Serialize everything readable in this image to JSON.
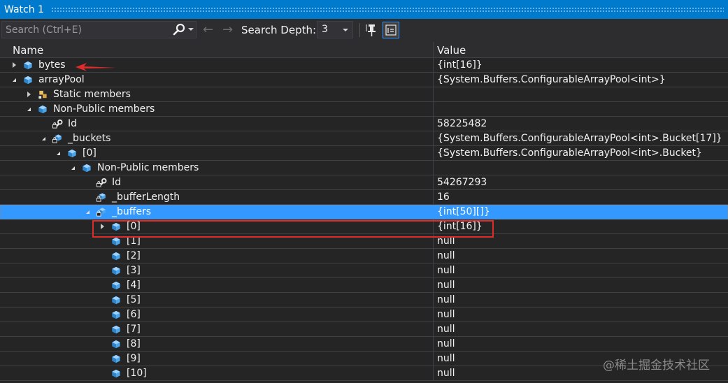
{
  "window": {
    "title": "Watch 1"
  },
  "toolbar": {
    "search_placeholder": "Search (Ctrl+E)",
    "search_depth_label": "Search Depth:",
    "search_depth_value": "3"
  },
  "columns": {
    "name": "Name",
    "value": "Value"
  },
  "rows": [
    {
      "name": "bytes",
      "value": "{int[16]}",
      "expander": "collapsed",
      "icon": "field-icon"
    },
    {
      "name": "arrayPool",
      "value": "{System.Buffers.ConfigurableArrayPool<int>}",
      "expander": "expanded",
      "icon": "field-icon"
    },
    {
      "name": "Static members",
      "value": "",
      "expander": "collapsed",
      "icon": "static-members-icon"
    },
    {
      "name": "Non-Public members",
      "value": "",
      "expander": "expanded",
      "icon": "field-icon"
    },
    {
      "name": "Id",
      "value": "58225482",
      "expander": "none",
      "icon": "private-property-icon"
    },
    {
      "name": "_buckets",
      "value": "{System.Buffers.ConfigurableArrayPool<int>.Bucket[17]}",
      "expander": "expanded",
      "icon": "private-field-icon"
    },
    {
      "name": "[0]",
      "value": "{System.Buffers.ConfigurableArrayPool<int>.Bucket}",
      "expander": "expanded",
      "icon": "field-icon"
    },
    {
      "name": "Non-Public members",
      "value": "",
      "expander": "expanded",
      "icon": "field-icon"
    },
    {
      "name": "Id",
      "value": "54267293",
      "expander": "none",
      "icon": "private-property-icon"
    },
    {
      "name": "_bufferLength",
      "value": "16",
      "expander": "none",
      "icon": "private-field-icon"
    },
    {
      "name": "_buffers",
      "value": "{int[50][]}",
      "expander": "expanded",
      "icon": "private-field-icon",
      "selected": true
    },
    {
      "name": "[0]",
      "value": "{int[16]}",
      "expander": "collapsed",
      "icon": "field-icon"
    },
    {
      "name": "[1]",
      "value": "null",
      "expander": "none",
      "icon": "field-icon"
    },
    {
      "name": "[2]",
      "value": "null",
      "expander": "none",
      "icon": "field-icon"
    },
    {
      "name": "[3]",
      "value": "null",
      "expander": "none",
      "icon": "field-icon"
    },
    {
      "name": "[4]",
      "value": "null",
      "expander": "none",
      "icon": "field-icon"
    },
    {
      "name": "[5]",
      "value": "null",
      "expander": "none",
      "icon": "field-icon"
    },
    {
      "name": "[6]",
      "value": "null",
      "expander": "none",
      "icon": "field-icon"
    },
    {
      "name": "[7]",
      "value": "null",
      "expander": "none",
      "icon": "field-icon"
    },
    {
      "name": "[8]",
      "value": "null",
      "expander": "none",
      "icon": "field-icon"
    },
    {
      "name": "[9]",
      "value": "null",
      "expander": "none",
      "icon": "field-icon"
    },
    {
      "name": "[10]",
      "value": "null",
      "expander": "none",
      "icon": "field-icon"
    }
  ],
  "annotation": {
    "highlight_color": "#e02b2b"
  },
  "watermark": {
    "text": "@稀土掘金技术社区"
  },
  "colors": {
    "accent": "#007acc",
    "selection": "#3399ff",
    "background": "#252526"
  }
}
